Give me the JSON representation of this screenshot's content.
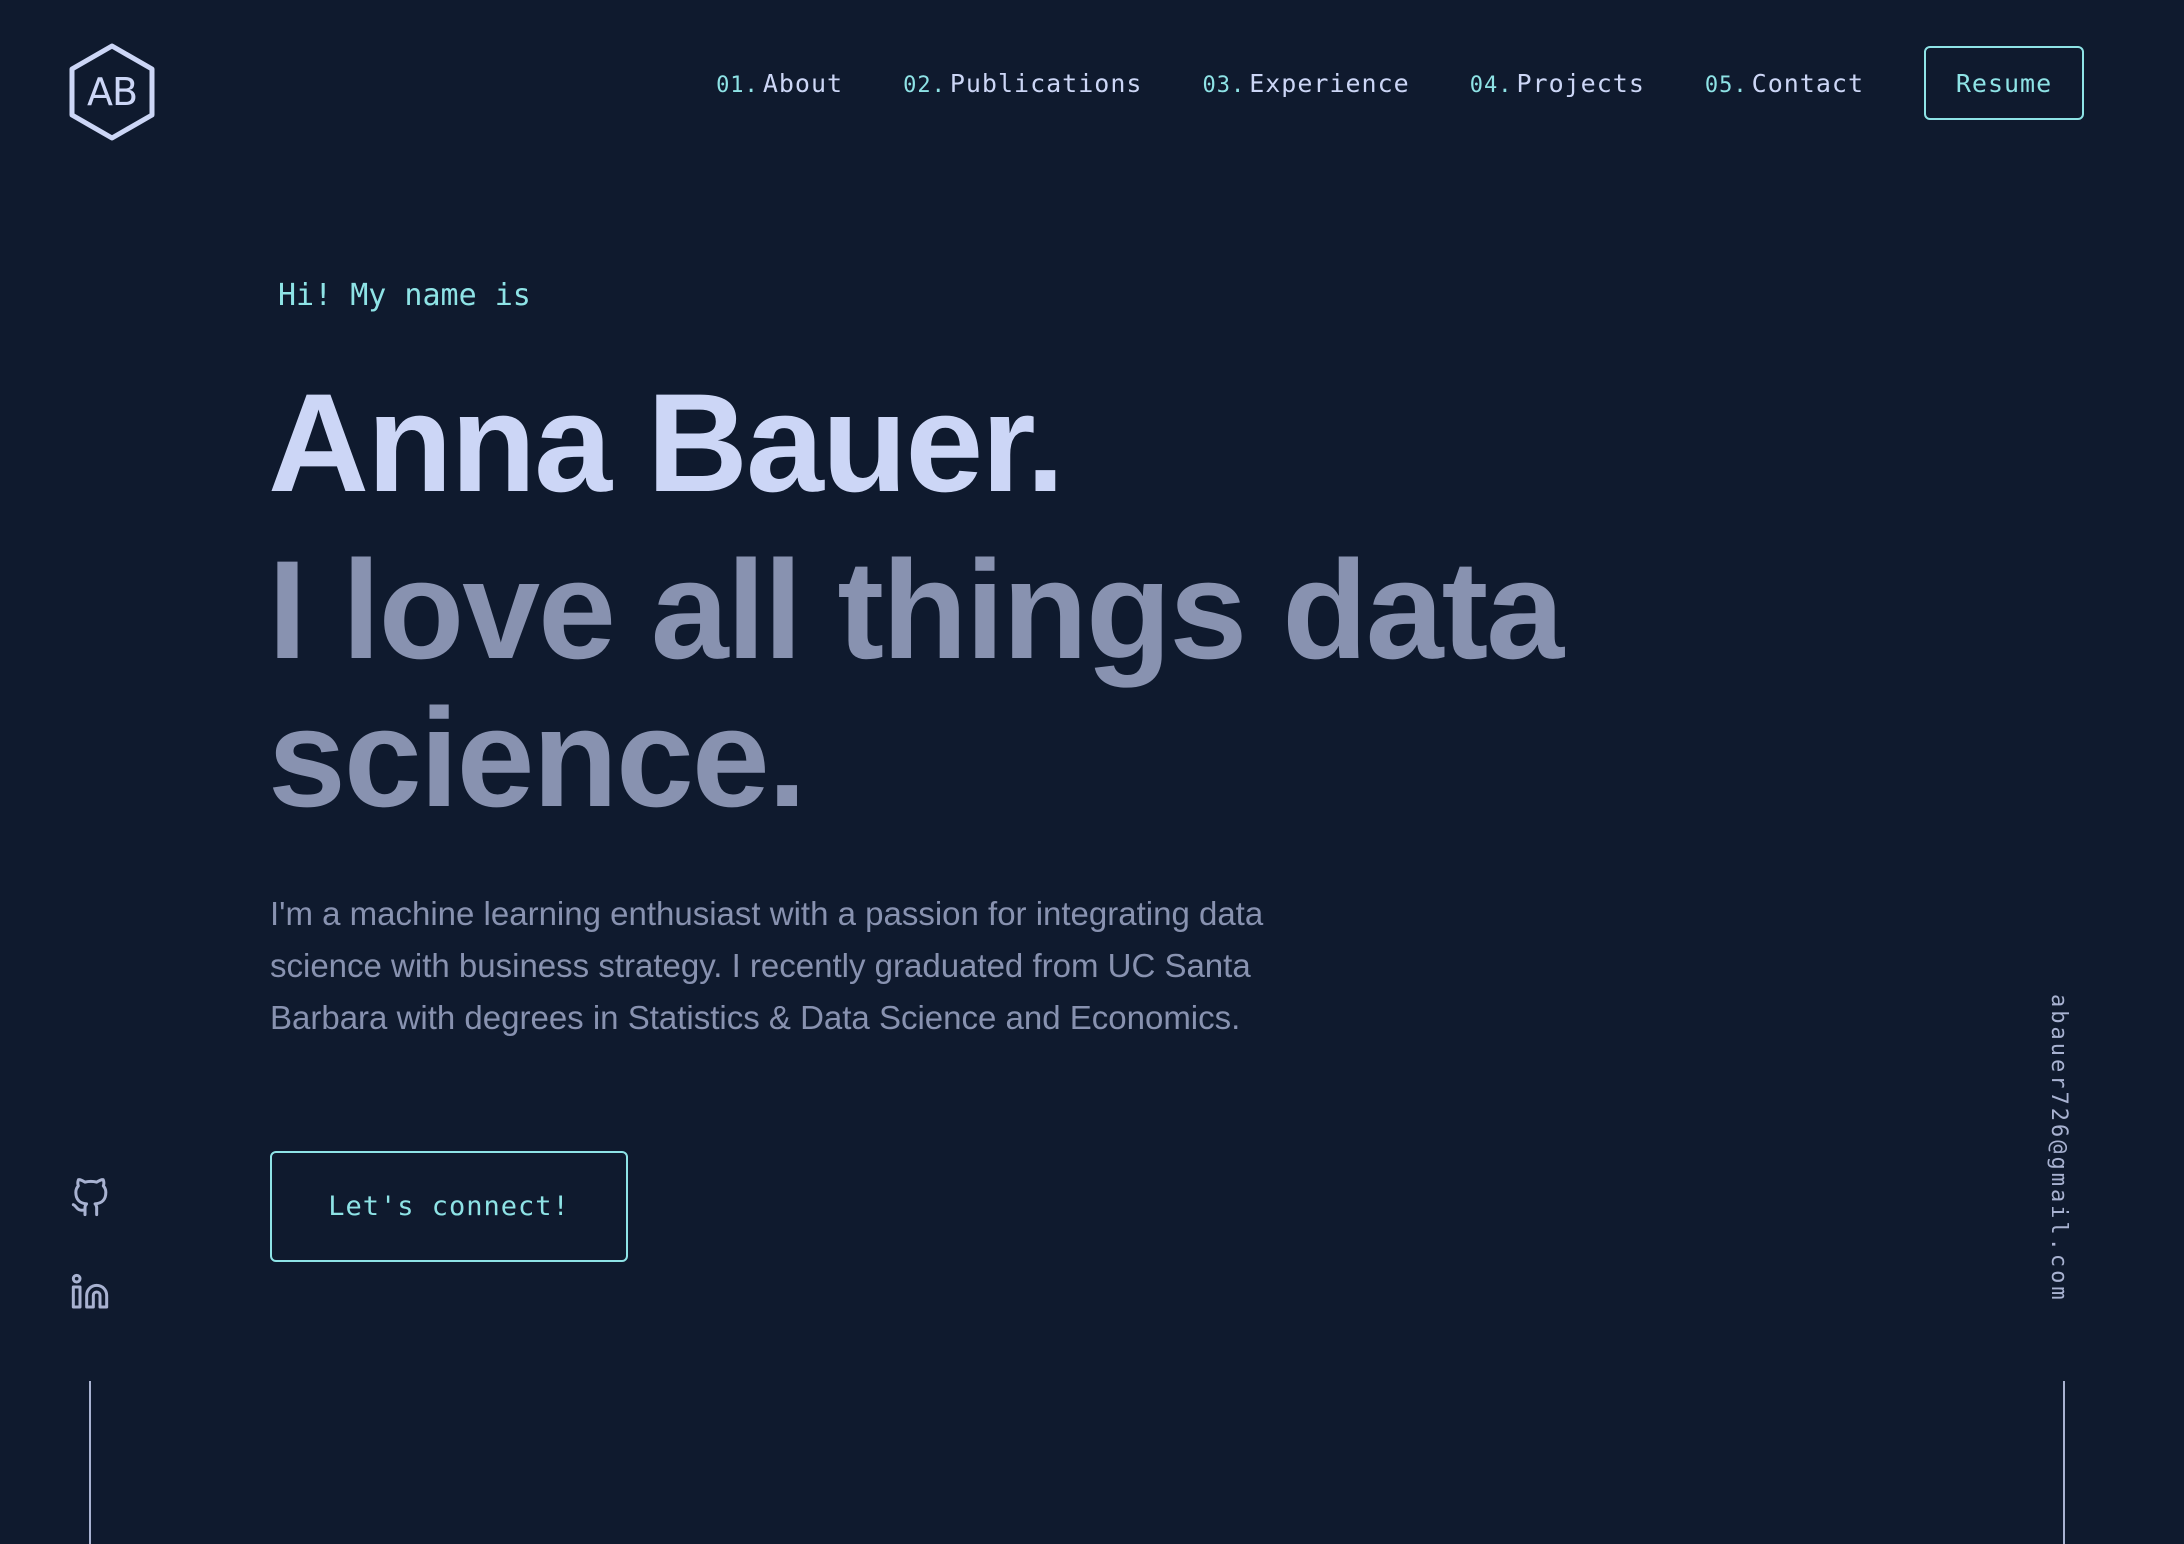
{
  "logo": {
    "text": "AB",
    "icon": "hexagon-icon"
  },
  "nav": {
    "items": [
      {
        "num": "01.",
        "label": "About"
      },
      {
        "num": "02.",
        "label": "Publications"
      },
      {
        "num": "03.",
        "label": "Experience"
      },
      {
        "num": "04.",
        "label": "Projects"
      },
      {
        "num": "05.",
        "label": "Contact"
      }
    ],
    "resume_label": "Resume"
  },
  "hero": {
    "greeting": "Hi! My name is",
    "name": "Anna Bauer.",
    "tagline": "I love all things data science.",
    "bio": "I'm a machine learning enthusiast with a passion for integrating data science with business strategy. I recently graduated from UC Santa Barbara with degrees in Statistics & Data Science and Economics.",
    "cta_label": "Let's connect!"
  },
  "social": {
    "icons": [
      "github-icon",
      "linkedin-icon"
    ]
  },
  "email": "abauer726@gmail.com",
  "colors": {
    "background": "#0f1a2e",
    "accent": "#8ee3e6",
    "heading": "#ccd6f6",
    "text": "#8892b0"
  }
}
